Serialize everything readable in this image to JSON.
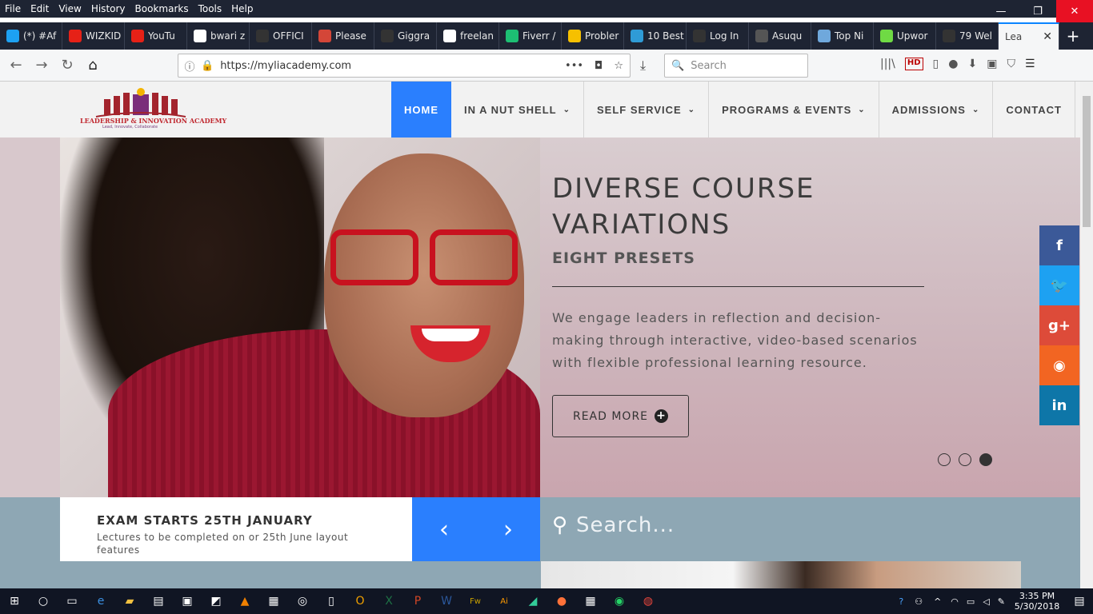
{
  "browser": {
    "menu": [
      "File",
      "Edit",
      "View",
      "History",
      "Bookmarks",
      "Tools",
      "Help"
    ],
    "window_controls": [
      "minimize-icon",
      "restore-icon",
      "close-icon"
    ],
    "tabs": [
      {
        "label": "(*) #Af",
        "icon": "twitter-icon",
        "color": "#1da1f2"
      },
      {
        "label": "WIZKID",
        "icon": "youtube-icon",
        "color": "#e62117"
      },
      {
        "label": "YouTu",
        "icon": "youtube-icon",
        "color": "#e62117"
      },
      {
        "label": "bwari z",
        "icon": "google-icon",
        "color": "#ffffff"
      },
      {
        "label": "OFFICI",
        "icon": "page-icon",
        "color": "#333333"
      },
      {
        "label": "Please",
        "icon": "gmail-icon",
        "color": "#d44638"
      },
      {
        "label": "Giggra",
        "icon": "page-icon",
        "color": "#333333"
      },
      {
        "label": "freelan",
        "icon": "google-icon",
        "color": "#ffffff"
      },
      {
        "label": "Fiverr /",
        "icon": "fiverr-icon",
        "color": "#1dbf73"
      },
      {
        "label": "Probler",
        "icon": "warning-icon",
        "color": "#f6c000"
      },
      {
        "label": "10 Best",
        "icon": "b-icon",
        "color": "#2f9bd6"
      },
      {
        "label": "Log In",
        "icon": "page-icon",
        "color": "#333333"
      },
      {
        "label": "Asuqu",
        "icon": "a-icon",
        "color": "#555555"
      },
      {
        "label": "Top Ni",
        "icon": "diamond-icon",
        "color": "#6fa8dc"
      },
      {
        "label": "Upwor",
        "icon": "upwork-icon",
        "color": "#6fda44"
      },
      {
        "label": "79 Wel",
        "icon": "f-icon",
        "color": "#333333"
      }
    ],
    "active_tab": {
      "label": "Lea"
    },
    "url": "https://myliacademy.com",
    "search_placeholder": "Search"
  },
  "site": {
    "logo_text": "LEADERSHIP & INNOVATION ACADEMY",
    "logo_tagline": "Lead, Innovate, Collaborate",
    "nav": [
      {
        "label": "HOME",
        "active": true,
        "dropdown": false
      },
      {
        "label": "IN A NUT SHELL",
        "active": false,
        "dropdown": true
      },
      {
        "label": "SELF SERVICE",
        "active": false,
        "dropdown": true
      },
      {
        "label": "PROGRAMS & EVENTS",
        "active": false,
        "dropdown": true
      },
      {
        "label": "ADMISSIONS",
        "active": false,
        "dropdown": true
      },
      {
        "label": "CONTACT",
        "active": false,
        "dropdown": false
      }
    ],
    "accent_color": "#2a7ffe",
    "hero": {
      "title": "DIVERSE COURSE VARIATIONS",
      "subtitle": "EIGHT PRESETS",
      "description": "We engage leaders in reflection and decision-making through interactive, video-based scenarios with flexible professional learning resource.",
      "button": "READ MORE",
      "slide_count": 3,
      "active_slide": 3
    },
    "social": [
      {
        "name": "facebook-icon",
        "glyph": "f",
        "color": "#3b5998"
      },
      {
        "name": "twitter-icon",
        "glyph": "🐦",
        "color": "#1da1f2"
      },
      {
        "name": "google-plus-icon",
        "glyph": "g+",
        "color": "#dd4b39"
      },
      {
        "name": "rss-icon",
        "glyph": "◉",
        "color": "#f26522"
      },
      {
        "name": "linkedin-icon",
        "glyph": "in",
        "color": "#0e76a8"
      }
    ],
    "news": {
      "title": "EXAM STARTS 25TH JANUARY",
      "text": "Lectures to be completed on or 25th June layout features"
    },
    "search_placeholder": "Search..."
  },
  "taskbar": {
    "time": "3:35 PM",
    "date": "5/30/2018"
  }
}
